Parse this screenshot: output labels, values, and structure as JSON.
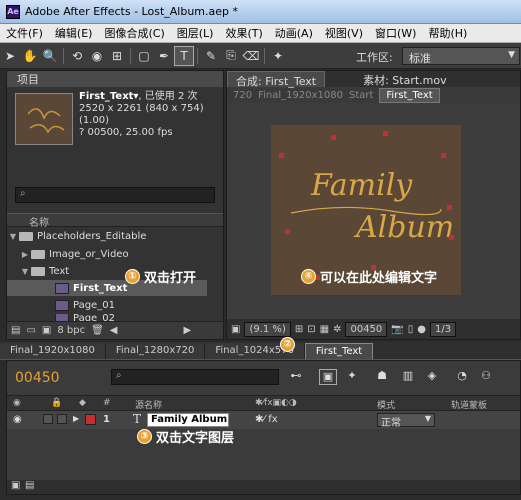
{
  "window": {
    "title": "Adobe After Effects - Lost_Album.aep *",
    "logo": "Ae"
  },
  "menu": [
    "文件(F)",
    "编辑(E)",
    "图像合成(C)",
    "图层(L)",
    "效果(T)",
    "动画(A)",
    "视图(V)",
    "窗口(W)",
    "帮助(H)"
  ],
  "toolbar": {
    "workspace_label": "工作区:",
    "workspace_value": "标准"
  },
  "project": {
    "tab": "项目",
    "item_name": "First_Text▾",
    "item_usage": ", 已使用 2 次",
    "item_dims": "2520 x 2261  (840 x 754) (1.00)",
    "item_duration": "? 00500, 25.00 fps",
    "col_name": "名称",
    "rows": [
      "Placeholders_Editable",
      "Image_or_Video",
      "Text",
      "First_Text",
      "Page_01",
      "Page_02"
    ],
    "bpc": "8 bpc"
  },
  "viewer": {
    "tab_comp": "合成: First_Text",
    "tab_footage": "素材: Start.mov",
    "crumbs": [
      "720",
      "Final_1920x1080",
      "Start",
      "First_Text"
    ],
    "canvas_text1": "Family",
    "canvas_text2": "Album",
    "zoom": "(9.1 %)",
    "timecode": "00450",
    "res": "1/3"
  },
  "timeline": {
    "tabs": [
      "Final_1920x1080",
      "Final_1280x720",
      "Final_1024x576",
      "First_Text"
    ],
    "timecode": "00450",
    "col_hash": "#",
    "col_source": "源名称",
    "col_mode": "模式",
    "col_track": "轨道蒙板",
    "layer_num": "1",
    "layer_name": "Family Album",
    "layer_mode": "正常"
  },
  "callouts": {
    "c1_num": "①",
    "c1": "双击打开",
    "c2_num": "②",
    "c3_num": "③",
    "c3": "双击文字图层",
    "c4_num": "④",
    "c4": "可以在此处编辑文字"
  },
  "colors": {
    "accent": "#e8a030",
    "canvas": "#5b4735",
    "handle": "#c23030"
  }
}
